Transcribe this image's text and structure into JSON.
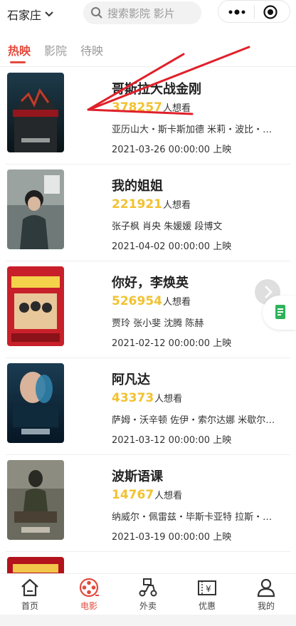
{
  "header": {
    "city": "石家庄",
    "search_placeholder": "搜索影院 影片"
  },
  "tabs": [
    {
      "label": "热映",
      "active": true
    },
    {
      "label": "影院",
      "active": false
    },
    {
      "label": "待映",
      "active": false
    }
  ],
  "want_suffix": "人想看",
  "release_suffix": "上映",
  "movies": [
    {
      "title": "哥斯拉大战金刚",
      "want_count": "378257",
      "cast": "亚历山大・斯卡斯加德 米莉・波比・布...",
      "release": "2021-03-26 00:00:00"
    },
    {
      "title": "我的姐姐",
      "want_count": "221921",
      "cast": "张子枫 肖央 朱媛媛 段博文",
      "release": "2021-04-02 00:00:00"
    },
    {
      "title": "你好，李焕英",
      "want_count": "526954",
      "cast": "贾玲 张小斐 沈腾 陈赫",
      "release": "2021-02-12 00:00:00"
    },
    {
      "title": "阿凡达",
      "want_count": "43373",
      "cast": "萨姆・沃辛顿 佐伊・索尔达娜 米歇尔・...",
      "release": "2021-03-12 00:00:00"
    },
    {
      "title": "波斯语课",
      "want_count": "14767",
      "cast": "纳威尔・佩雷兹・毕斯卡亚特 拉斯・艾...",
      "release": "2021-03-19 00:00:00"
    }
  ],
  "bottom_nav": [
    {
      "label": "首页",
      "icon": "home-icon",
      "active": false
    },
    {
      "label": "电影",
      "icon": "film-reel-icon",
      "active": true
    },
    {
      "label": "外卖",
      "icon": "scooter-icon",
      "active": false
    },
    {
      "label": "优惠",
      "icon": "coupon-icon",
      "active": false
    },
    {
      "label": "我的",
      "icon": "person-icon",
      "active": false
    }
  ],
  "colors": {
    "accent": "#e24a3c",
    "want_number": "#f2c230",
    "annotation_arrow": "#e0202a"
  }
}
